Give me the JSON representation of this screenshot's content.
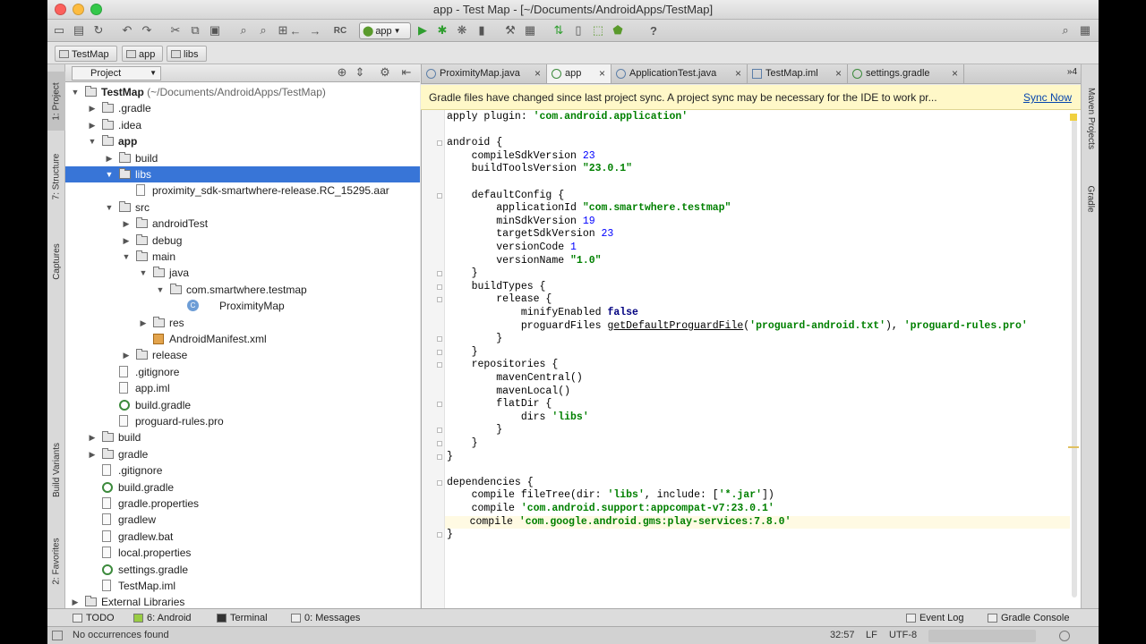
{
  "window": {
    "title": "app - Test Map - [~/Documents/AndroidApps/TestMap]"
  },
  "toolbar": {
    "run_config": "app",
    "help": "?"
  },
  "breadcrumbs": [
    "TestMap",
    "app",
    "libs"
  ],
  "left_strip": [
    "1: Project",
    "7: Structure",
    "Captures",
    "Build Variants",
    "2: Favorites"
  ],
  "right_strip": [
    "Maven Projects",
    "Gradle"
  ],
  "project_panel": {
    "selector": "Project"
  },
  "tree": [
    {
      "depth": 0,
      "arrow": "down",
      "icon": "folder",
      "label": "TestMap",
      "suffix": " (~/Documents/AndroidApps/TestMap)"
    },
    {
      "depth": 1,
      "arrow": "right",
      "icon": "folder",
      "label": ".gradle"
    },
    {
      "depth": 1,
      "arrow": "right",
      "icon": "folder",
      "label": ".idea"
    },
    {
      "depth": 1,
      "arrow": "down",
      "icon": "folder",
      "label": "app"
    },
    {
      "depth": 2,
      "arrow": "right",
      "icon": "folder",
      "label": "build"
    },
    {
      "depth": 2,
      "arrow": "down",
      "icon": "folder",
      "label": "libs",
      "selected": true
    },
    {
      "depth": 3,
      "arrow": "",
      "icon": "file",
      "label": "proximity_sdk-smartwhere-release.RC_15295.aar"
    },
    {
      "depth": 2,
      "arrow": "down",
      "icon": "folder",
      "label": "src"
    },
    {
      "depth": 3,
      "arrow": "right",
      "icon": "folder",
      "label": "androidTest"
    },
    {
      "depth": 3,
      "arrow": "right",
      "icon": "folder",
      "label": "debug"
    },
    {
      "depth": 3,
      "arrow": "down",
      "icon": "folder",
      "label": "main"
    },
    {
      "depth": 4,
      "arrow": "down",
      "icon": "folder",
      "label": "java"
    },
    {
      "depth": 5,
      "arrow": "down",
      "icon": "folder",
      "label": "com.smartwhere.testmap"
    },
    {
      "depth": 6,
      "arrow": "",
      "icon": "class",
      "label": "ProximityMap"
    },
    {
      "depth": 4,
      "arrow": "right",
      "icon": "folder",
      "label": "res"
    },
    {
      "depth": 4,
      "arrow": "",
      "icon": "xml",
      "label": "AndroidManifest.xml"
    },
    {
      "depth": 3,
      "arrow": "right",
      "icon": "folder",
      "label": "release"
    },
    {
      "depth": 2,
      "arrow": "",
      "icon": "file",
      "label": ".gitignore"
    },
    {
      "depth": 2,
      "arrow": "",
      "icon": "file",
      "label": "app.iml"
    },
    {
      "depth": 2,
      "arrow": "",
      "icon": "gradle",
      "label": "build.gradle"
    },
    {
      "depth": 2,
      "arrow": "",
      "icon": "file",
      "label": "proguard-rules.pro"
    },
    {
      "depth": 1,
      "arrow": "right",
      "icon": "folder",
      "label": "build"
    },
    {
      "depth": 1,
      "arrow": "right",
      "icon": "folder",
      "label": "gradle"
    },
    {
      "depth": 1,
      "arrow": "",
      "icon": "file",
      "label": ".gitignore"
    },
    {
      "depth": 1,
      "arrow": "",
      "icon": "gradle",
      "label": "build.gradle"
    },
    {
      "depth": 1,
      "arrow": "",
      "icon": "file",
      "label": "gradle.properties"
    },
    {
      "depth": 1,
      "arrow": "",
      "icon": "file",
      "label": "gradlew"
    },
    {
      "depth": 1,
      "arrow": "",
      "icon": "file",
      "label": "gradlew.bat"
    },
    {
      "depth": 1,
      "arrow": "",
      "icon": "file",
      "label": "local.properties"
    },
    {
      "depth": 1,
      "arrow": "",
      "icon": "gradle",
      "label": "settings.gradle"
    },
    {
      "depth": 1,
      "arrow": "",
      "icon": "file",
      "label": "TestMap.iml"
    },
    {
      "depth": 0,
      "arrow": "right",
      "icon": "folder",
      "label": "External Libraries"
    }
  ],
  "editor_tabs": [
    {
      "label": "ProximityMap.java",
      "active": false
    },
    {
      "label": "app",
      "active": true
    },
    {
      "label": "ApplicationTest.java",
      "active": false
    },
    {
      "label": "TestMap.iml",
      "active": false
    },
    {
      "label": "settings.gradle",
      "active": false
    }
  ],
  "tab_overflow": "4",
  "notification": {
    "text": "Gradle files have changed since last project sync. A project sync may be necessary for the IDE to work pr...",
    "action": "Sync Now"
  },
  "code": [
    "apply plugin: 'com.android.application'",
    "",
    "android {",
    "    compileSdkVersion 23",
    "    buildToolsVersion \"23.0.1\"",
    "",
    "    defaultConfig {",
    "        applicationId \"com.smartwhere.testmap\"",
    "        minSdkVersion 19",
    "        targetSdkVersion 23",
    "        versionCode 1",
    "        versionName \"1.0\"",
    "    }",
    "    buildTypes {",
    "        release {",
    "            minifyEnabled false",
    "            proguardFiles getDefaultProguardFile('proguard-android.txt'), 'proguard-rules.pro'",
    "        }",
    "    }",
    "    repositories {",
    "        mavenCentral()",
    "        mavenLocal()",
    "        flatDir {",
    "            dirs 'libs'",
    "        }",
    "    }",
    "}",
    "",
    "dependencies {",
    "    compile fileTree(dir: 'libs', include: ['*.jar'])",
    "    compile 'com.android.support:appcompat-v7:23.0.1'",
    "    compile 'com.google.android.gms:play-services:7.8.0'",
    "}"
  ],
  "bottom_tools": {
    "left": [
      "TODO",
      "6: Android",
      "Terminal",
      "0: Messages"
    ],
    "right": [
      "Event Log",
      "Gradle Console"
    ]
  },
  "status": {
    "message": "No occurrences found",
    "position": "32:57",
    "line_sep": "LF",
    "encoding": "UTF-8"
  },
  "colors": {
    "selection": "#3875d7",
    "notification_bg": "#fff8c8",
    "string": "#008000",
    "number": "#0000ff",
    "link": "#0645ad"
  }
}
